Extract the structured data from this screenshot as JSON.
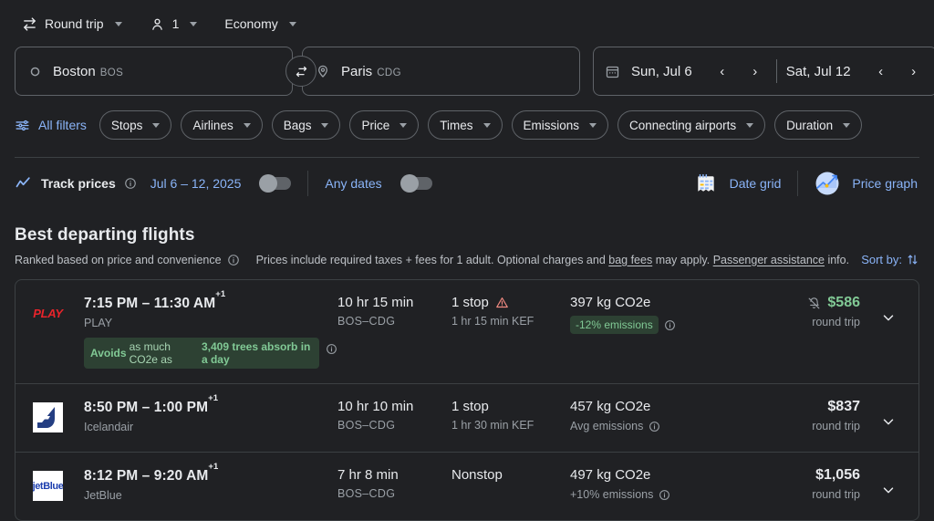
{
  "topbar": {
    "trip_type": "Round trip",
    "passengers": "1",
    "cabin_class": "Economy",
    "trip_icon": "swap-horizontal-icon",
    "passenger_icon": "person-icon"
  },
  "search": {
    "origin": {
      "city": "Boston",
      "code": "BOS",
      "icon": "circle-icon"
    },
    "destination": {
      "city": "Paris",
      "code": "CDG",
      "icon": "location-pin-icon"
    },
    "swap_icon": "swap-arrows-icon",
    "calendar_icon": "calendar-icon",
    "depart_date": "Sun, Jul 6",
    "return_date": "Sat, Jul 12",
    "prev_symbol": "‹",
    "next_symbol": "›"
  },
  "filters": {
    "all_filters_label": "All filters",
    "all_filters_icon": "tune-filter-icon",
    "pills": [
      {
        "label": "Stops"
      },
      {
        "label": "Airlines"
      },
      {
        "label": "Bags"
      },
      {
        "label": "Price"
      },
      {
        "label": "Times"
      },
      {
        "label": "Emissions"
      },
      {
        "label": "Connecting airports"
      },
      {
        "label": "Duration"
      }
    ]
  },
  "track": {
    "icon": "trending-line-icon",
    "label": "Track prices",
    "info_icon": "info-icon",
    "dates": "Jul 6 – 12, 2025",
    "any_dates_label": "Any dates",
    "date_grid_label": "Date grid",
    "date_grid_icon": "calendar-grid-icon",
    "price_graph_label": "Price graph",
    "price_graph_icon": "price-graph-icon"
  },
  "best": {
    "title": "Best departing flights",
    "ranked_note": "Ranked based on price and convenience",
    "info_icon": "info-icon",
    "prices_note_pre": "Prices include required taxes + fees for 1 adult. Optional charges and ",
    "bag_fees_link": "bag fees",
    "prices_note_mid": " may apply. ",
    "passenger_assistance_link": "Passenger assistance",
    "prices_note_post": " info.",
    "sort_by_label": "Sort by:",
    "sort_icon": "sort-arrows-icon"
  },
  "flights": [
    {
      "logo_type": "play",
      "logo_text": "PLAY",
      "times": "7:15 PM – 11:30 AM",
      "day_offset": "+1",
      "airline": "PLAY",
      "eco_badge_bold": "Avoids",
      "eco_badge_normal": "as much CO2e as",
      "eco_badge_bold2": "3,409 trees absorb in a day",
      "eco_badge_info_icon": "info-icon",
      "duration": "10 hr 15 min",
      "route": "BOS–CDG",
      "stops": "1 stop",
      "stops_warning_icon": "warning-triangle-icon",
      "stop_detail": "1 hr 15 min KEF",
      "emissions": "397 kg CO2e",
      "emissions_badge": "-12% emissions",
      "emissions_badge_style": "green",
      "emissions_info_icon": "info-icon",
      "price": "$586",
      "price_green": true,
      "price_icon": "bell-off-icon",
      "trip_type": "round trip",
      "expand_icon": "chevron-down-icon"
    },
    {
      "logo_type": "icelandair",
      "logo_text": "",
      "times": "8:50 PM – 1:00 PM",
      "day_offset": "+1",
      "airline": "Icelandair",
      "duration": "10 hr 10 min",
      "route": "BOS–CDG",
      "stops": "1 stop",
      "stop_detail": "1 hr 30 min KEF",
      "emissions": "457 kg CO2e",
      "emissions_badge": "Avg emissions",
      "emissions_badge_style": "plain",
      "emissions_info_icon": "info-icon",
      "price": "$837",
      "price_green": false,
      "trip_type": "round trip",
      "expand_icon": "chevron-down-icon"
    },
    {
      "logo_type": "jetblue",
      "logo_text": "jetBlue",
      "times": "8:12 PM – 9:20 AM",
      "day_offset": "+1",
      "airline": "JetBlue",
      "duration": "7 hr 8 min",
      "route": "BOS–CDG",
      "stops": "Nonstop",
      "stop_detail": "",
      "emissions": "497 kg CO2e",
      "emissions_badge": "+10% emissions",
      "emissions_badge_style": "plain",
      "emissions_info_icon": "info-icon",
      "price": "$1,056",
      "price_green": false,
      "trip_type": "round trip",
      "expand_icon": "chevron-down-icon"
    }
  ],
  "colors": {
    "background": "#202124",
    "accent_blue": "#8ab4f8",
    "green": "#81c995",
    "border": "#3c4043",
    "muted_text": "#9aa0a6"
  }
}
